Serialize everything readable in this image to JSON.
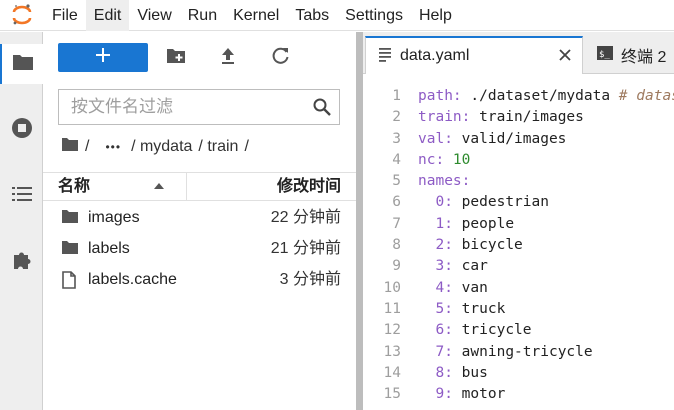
{
  "menu": {
    "items": [
      "File",
      "Edit",
      "View",
      "Run",
      "Kernel",
      "Tabs",
      "Settings",
      "Help"
    ],
    "active_index": 1
  },
  "activity": {
    "items": [
      "folder-icon",
      "stop-circle-icon",
      "list-icon",
      "puzzle-icon"
    ],
    "active": "folder-icon"
  },
  "filebrowser": {
    "new_label": "+",
    "search": {
      "placeholder": "按文件名过滤",
      "value": ""
    },
    "breadcrumb": {
      "root": "/",
      "ellipsis": "•••",
      "parts": [
        "/ mydata",
        "/ train",
        "/"
      ]
    },
    "columns": {
      "name": "名称",
      "modified": "修改时间"
    },
    "files": [
      {
        "name": "images",
        "type": "folder",
        "modified": "22 分钟前"
      },
      {
        "name": "labels",
        "type": "folder",
        "modified": "21 分钟前"
      },
      {
        "name": "labels.cache",
        "type": "file",
        "modified": "3 分钟前"
      }
    ]
  },
  "editor": {
    "tabs": [
      {
        "label": "data.yaml",
        "active": true
      },
      {
        "label": "终端 2",
        "active": false
      }
    ],
    "lines": [
      {
        "n": "1",
        "key": "path:",
        "val": " ./dataset/mydata ",
        "comment": "# dataset root dir"
      },
      {
        "n": "2",
        "key": "train:",
        "val": " train/images"
      },
      {
        "n": "3",
        "key": "val:",
        "val": " valid/images"
      },
      {
        "n": "4",
        "key": "nc:",
        "num": " 10"
      },
      {
        "n": "5",
        "key": "names:",
        "val": ""
      },
      {
        "n": "6",
        "indent": "  ",
        "key": "0:",
        "val": " pedestrian"
      },
      {
        "n": "7",
        "indent": "  ",
        "key": "1:",
        "val": " people"
      },
      {
        "n": "8",
        "indent": "  ",
        "key": "2:",
        "val": " bicycle"
      },
      {
        "n": "9",
        "indent": "  ",
        "key": "3:",
        "val": " car"
      },
      {
        "n": "10",
        "indent": "  ",
        "key": "4:",
        "val": " van"
      },
      {
        "n": "11",
        "indent": "  ",
        "key": "5:",
        "val": " truck"
      },
      {
        "n": "12",
        "indent": "  ",
        "key": "6:",
        "val": " tricycle"
      },
      {
        "n": "13",
        "indent": "  ",
        "key": "7:",
        "val": " awning-tricycle"
      },
      {
        "n": "14",
        "indent": "  ",
        "key": "8:",
        "val": " bus"
      },
      {
        "n": "15",
        "indent": "  ",
        "key": "9:",
        "val": " motor"
      }
    ]
  },
  "colors": {
    "accent": "#1976d2",
    "keyword": "#8d5bc5",
    "number": "#2e8b2e",
    "comment": "#9e7a5f"
  }
}
